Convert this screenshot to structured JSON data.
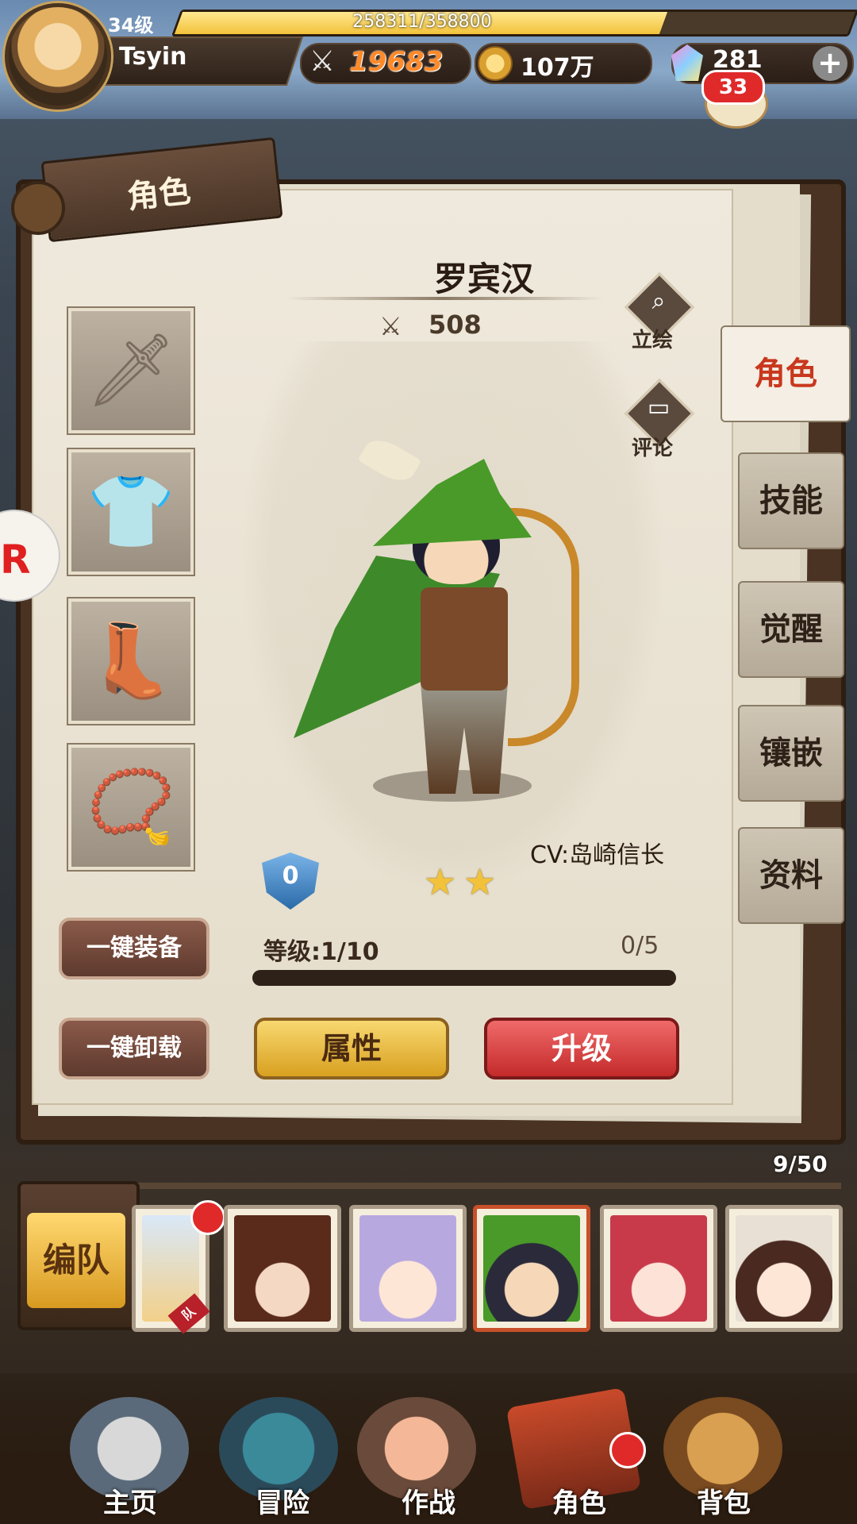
{
  "player": {
    "level": "34级",
    "exp_text": "258311/358800",
    "exp_progress": 0.72,
    "name": "Tsyin",
    "power": "19683",
    "gold": "107万",
    "gems": "281",
    "chat_unread": "33"
  },
  "panel": {
    "tag_title": "角色",
    "character_name": "罗宾汉",
    "character_power": "508",
    "portrait_label": "立绘",
    "review_label": "评论",
    "cv": "CV:岛崎信长",
    "rank": "0",
    "stars": 2,
    "level_text": "等级:1/10",
    "progress_text": "0/5",
    "equip_all": "一键装备",
    "unequip_all": "一键卸载",
    "attributes": "属性",
    "upgrade": "升级"
  },
  "tabs": [
    "角色",
    "技能",
    "觉醒",
    "镶嵌",
    "资料"
  ],
  "roster": {
    "count": "9/50",
    "team_button": "编队",
    "card_tag": "队"
  },
  "nav": [
    "主页",
    "冒险",
    "作战",
    "角色",
    "背包"
  ],
  "icons": {
    "power": "crossed-swords-icon",
    "gold": "coin-icon",
    "gem": "crystal-icon",
    "plus": "plus-icon",
    "chat": "chat-bubble-icon",
    "portrait": "magnifier-icon",
    "review": "speech-bubble-icon",
    "rank": "shield-icon",
    "star": "star-icon"
  },
  "colors": {
    "accent_red": "#e02a2a",
    "gold_button": "#f2c23a",
    "active_tab_text": "#c8381e",
    "power_text": "#ff8a2a"
  }
}
